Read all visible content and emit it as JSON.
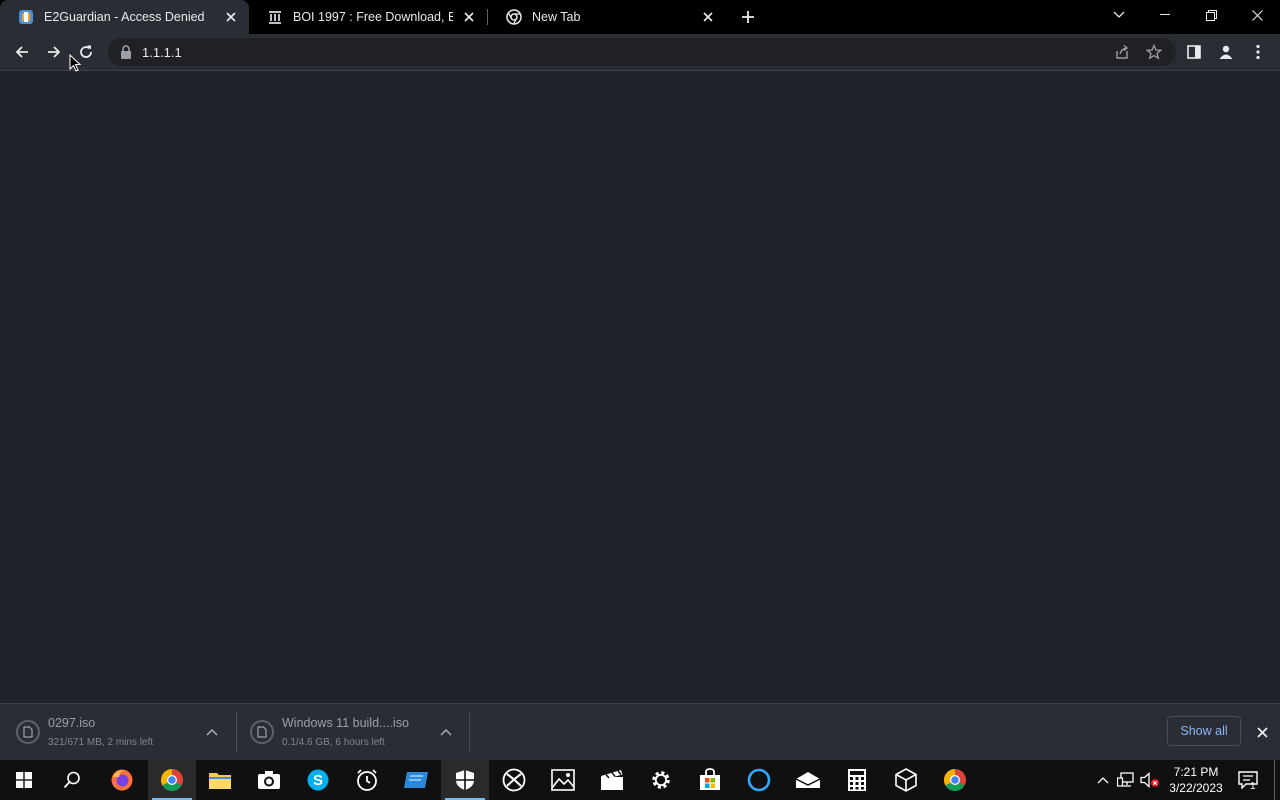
{
  "browser": {
    "tabs": [
      {
        "title": "E2Guardian - Access Denied",
        "favicon": "e2guardian-icon",
        "active": true
      },
      {
        "title": "BOI 1997 : Free Download, Borrow",
        "favicon": "archive-org-icon",
        "active": false
      },
      {
        "title": "New Tab",
        "favicon": "chrome-icon",
        "active": false
      }
    ],
    "address_bar": {
      "url": "1.1.1.1",
      "secure_icon": "lock-icon"
    },
    "toolbar_icons": [
      "back-arrow-icon",
      "forward-arrow-icon",
      "reload-icon",
      "share-icon",
      "star-icon",
      "side-panel-icon",
      "profile-icon",
      "more-icon"
    ]
  },
  "downloads": {
    "items": [
      {
        "name": "0297.iso",
        "status": "321/671 MB, 2 mins left"
      },
      {
        "name": "Windows 11 build....iso",
        "status": "0.1/4.6 GB, 6 hours left"
      }
    ],
    "show_all_label": "Show all"
  },
  "taskbar": {
    "apps": [
      "windows-start-icon",
      "search-icon",
      "firefox-icon",
      "chrome-icon",
      "file-explorer-icon",
      "camera-icon",
      "skype-icon",
      "alarms-clock-icon",
      "remote-desktop-icon",
      "windows-security-icon",
      "xbox-icon",
      "photos-icon",
      "movies-tv-icon",
      "settings-icon",
      "microsoft-store-icon",
      "cortana-icon",
      "mail-icon",
      "calculator-icon",
      "3d-viewer-icon",
      "chrome-icon"
    ],
    "clock": {
      "time": "7:21 PM",
      "date": "3/22/2023"
    },
    "notification_count": "1"
  },
  "colors": {
    "page_bg": "#1f222b",
    "toolbar_bg": "#2b2d34",
    "accent_link": "#8ab4f8",
    "taskbar_active": "#76b9ed"
  }
}
